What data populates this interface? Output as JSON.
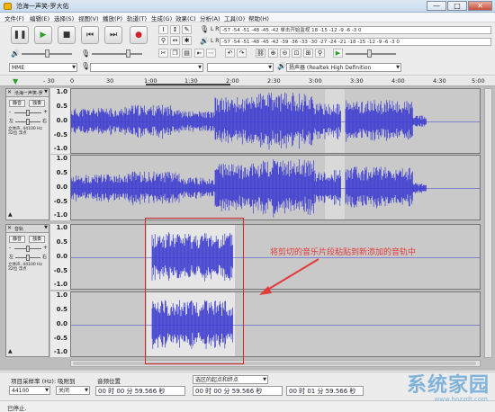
{
  "window": {
    "title": "沧海一声笑-罗大佑",
    "minimize_label": "—",
    "maximize_label": "□",
    "close_label": "✕"
  },
  "menu": [
    "文件(F)",
    "编辑(E)",
    "选择(S)",
    "视图(V)",
    "播放(P)",
    "轨道(T)",
    "生成(G)",
    "效果(C)",
    "分析(A)",
    "工具(O)",
    "帮助(H)"
  ],
  "meter_rows": {
    "record": "-57  -54  -51  -48  -45  -42   单击开始监视   18  -15  -12   -9   -6   -3   0",
    "play": "-57  -54  -51  -48  -45  -42  -39  -36  -33  -30  -27  -24  -21  -18  -15  -12   -9   -6   -3   0"
  },
  "device": {
    "host": "MME",
    "output_prefix": "扬声器 (Realtek High Definition"
  },
  "ruler": {
    "ticks": [
      "- 30",
      "0",
      "30",
      "1:00",
      "1:30",
      "2:00",
      "2:30",
      "3:00",
      "3:30",
      "4:00",
      "4:30",
      "5:00"
    ]
  },
  "tracks": [
    {
      "name": "沧海一声笑-罗大佑",
      "mute": "静音",
      "solo": "独奏",
      "gain_minus": "-",
      "gain_plus": "+",
      "pan_left": "左",
      "pan_right": "右",
      "info": "立体声, 44100 Hz\n32位 浮点",
      "scale_top": [
        "1.0",
        "0.5",
        "0.0",
        "-0.5",
        "-1.0"
      ],
      "scale_bottom": [
        "1.0",
        "0.5",
        "0.0",
        "-0.5",
        "-1.0"
      ]
    },
    {
      "name": "音轨",
      "mute": "静音",
      "solo": "独奏",
      "gain_minus": "-",
      "gain_plus": "+",
      "pan_left": "左",
      "pan_right": "右",
      "info": "立体声, 44100 Hz\n32位 浮点",
      "scale_top": [
        "1.0",
        "0.5",
        "0.0",
        "-0.5",
        "-1.0"
      ],
      "scale_bottom": [
        "1.0",
        "0.5",
        "0.0",
        "-0.5",
        "-1.0"
      ]
    }
  ],
  "annotation": "将剪切的音乐片段粘贴到新添加的音轨中",
  "bottom": {
    "rate_label": "项目采样率 (Hz):",
    "rate_value": "44100",
    "snap_label": "吸附到",
    "snap_value": "关闭",
    "pos_label": "音频位置",
    "pos_value": "00 时 00 分 59.566 秒",
    "sel_label": "选区的起点和终点",
    "sel_start": "00 时 00 分 59.566 秒",
    "sel_end": "00 时 01 分 59.566 秒"
  },
  "status": "已停止.",
  "watermark": "系统家园",
  "watermark_url": "www.hnzzdt.com",
  "colors": {
    "wave": "#3b3bd1",
    "wave_bg": "#c9c9c9",
    "selection": "#d0262c",
    "annotation": "#e23b3b"
  }
}
